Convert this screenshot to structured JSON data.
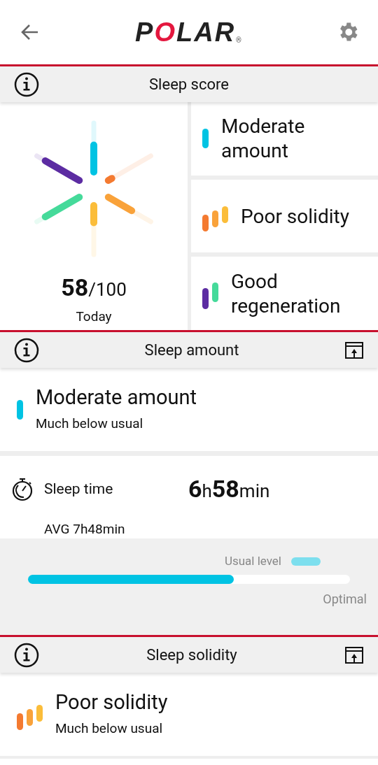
{
  "header": {
    "logo": "POLAR",
    "logo_mark": "®"
  },
  "sleep_score": {
    "title": "Sleep score",
    "score": "58",
    "max": "/100",
    "day": "Today",
    "ratings": [
      {
        "label": "Moderate amount",
        "bars": [
          {
            "color": "#00c3e3"
          }
        ]
      },
      {
        "label": "Poor solidity",
        "bars": [
          {
            "color": "#f47a30"
          },
          {
            "color": "#f9a23a"
          },
          {
            "color": "#fbbd3a"
          }
        ]
      },
      {
        "label": "Good regeneration",
        "bars": [
          {
            "color": "#5c2ca2"
          },
          {
            "color": "#45da9a"
          }
        ]
      }
    ]
  },
  "sleep_amount": {
    "title": "Sleep amount",
    "summary": {
      "label": "Moderate amount",
      "detail": "Much below usual",
      "bars": [
        {
          "color": "#00c3e3"
        }
      ]
    },
    "sleep_time": {
      "label": "Sleep time",
      "hours": "6",
      "h_unit": "h",
      "minutes": "58",
      "m_unit": "min",
      "average": "AVG 7h48min"
    },
    "meter": {
      "legend": "Usual level",
      "level": 0.64,
      "end_label": "Optimal"
    }
  },
  "sleep_solidity": {
    "title": "Sleep solidity",
    "summary": {
      "label": "Poor solidity",
      "detail": "Much below usual",
      "bars": [
        {
          "color": "#f47a30"
        },
        {
          "color": "#f9a23a"
        },
        {
          "color": "#fbbd3a"
        }
      ]
    }
  }
}
